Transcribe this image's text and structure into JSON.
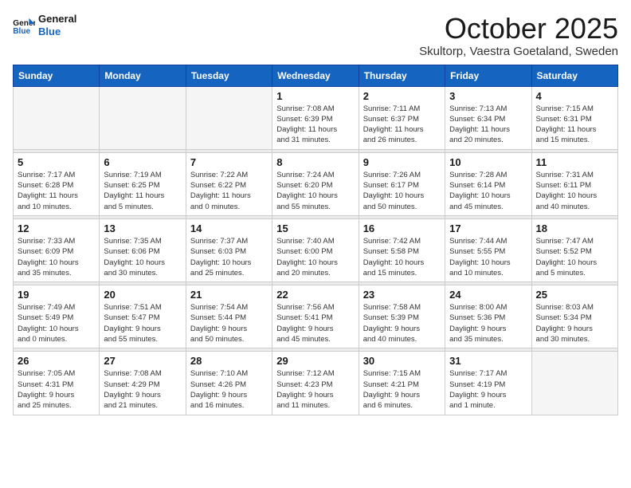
{
  "logo": {
    "line1": "General",
    "line2": "Blue"
  },
  "title": "October 2025",
  "location": "Skultorp, Vaestra Goetaland, Sweden",
  "days_of_week": [
    "Sunday",
    "Monday",
    "Tuesday",
    "Wednesday",
    "Thursday",
    "Friday",
    "Saturday"
  ],
  "weeks": [
    [
      {
        "day": "",
        "info": ""
      },
      {
        "day": "",
        "info": ""
      },
      {
        "day": "",
        "info": ""
      },
      {
        "day": "1",
        "info": "Sunrise: 7:08 AM\nSunset: 6:39 PM\nDaylight: 11 hours\nand 31 minutes."
      },
      {
        "day": "2",
        "info": "Sunrise: 7:11 AM\nSunset: 6:37 PM\nDaylight: 11 hours\nand 26 minutes."
      },
      {
        "day": "3",
        "info": "Sunrise: 7:13 AM\nSunset: 6:34 PM\nDaylight: 11 hours\nand 20 minutes."
      },
      {
        "day": "4",
        "info": "Sunrise: 7:15 AM\nSunset: 6:31 PM\nDaylight: 11 hours\nand 15 minutes."
      }
    ],
    [
      {
        "day": "5",
        "info": "Sunrise: 7:17 AM\nSunset: 6:28 PM\nDaylight: 11 hours\nand 10 minutes."
      },
      {
        "day": "6",
        "info": "Sunrise: 7:19 AM\nSunset: 6:25 PM\nDaylight: 11 hours\nand 5 minutes."
      },
      {
        "day": "7",
        "info": "Sunrise: 7:22 AM\nSunset: 6:22 PM\nDaylight: 11 hours\nand 0 minutes."
      },
      {
        "day": "8",
        "info": "Sunrise: 7:24 AM\nSunset: 6:20 PM\nDaylight: 10 hours\nand 55 minutes."
      },
      {
        "day": "9",
        "info": "Sunrise: 7:26 AM\nSunset: 6:17 PM\nDaylight: 10 hours\nand 50 minutes."
      },
      {
        "day": "10",
        "info": "Sunrise: 7:28 AM\nSunset: 6:14 PM\nDaylight: 10 hours\nand 45 minutes."
      },
      {
        "day": "11",
        "info": "Sunrise: 7:31 AM\nSunset: 6:11 PM\nDaylight: 10 hours\nand 40 minutes."
      }
    ],
    [
      {
        "day": "12",
        "info": "Sunrise: 7:33 AM\nSunset: 6:09 PM\nDaylight: 10 hours\nand 35 minutes."
      },
      {
        "day": "13",
        "info": "Sunrise: 7:35 AM\nSunset: 6:06 PM\nDaylight: 10 hours\nand 30 minutes."
      },
      {
        "day": "14",
        "info": "Sunrise: 7:37 AM\nSunset: 6:03 PM\nDaylight: 10 hours\nand 25 minutes."
      },
      {
        "day": "15",
        "info": "Sunrise: 7:40 AM\nSunset: 6:00 PM\nDaylight: 10 hours\nand 20 minutes."
      },
      {
        "day": "16",
        "info": "Sunrise: 7:42 AM\nSunset: 5:58 PM\nDaylight: 10 hours\nand 15 minutes."
      },
      {
        "day": "17",
        "info": "Sunrise: 7:44 AM\nSunset: 5:55 PM\nDaylight: 10 hours\nand 10 minutes."
      },
      {
        "day": "18",
        "info": "Sunrise: 7:47 AM\nSunset: 5:52 PM\nDaylight: 10 hours\nand 5 minutes."
      }
    ],
    [
      {
        "day": "19",
        "info": "Sunrise: 7:49 AM\nSunset: 5:49 PM\nDaylight: 10 hours\nand 0 minutes."
      },
      {
        "day": "20",
        "info": "Sunrise: 7:51 AM\nSunset: 5:47 PM\nDaylight: 9 hours\nand 55 minutes."
      },
      {
        "day": "21",
        "info": "Sunrise: 7:54 AM\nSunset: 5:44 PM\nDaylight: 9 hours\nand 50 minutes."
      },
      {
        "day": "22",
        "info": "Sunrise: 7:56 AM\nSunset: 5:41 PM\nDaylight: 9 hours\nand 45 minutes."
      },
      {
        "day": "23",
        "info": "Sunrise: 7:58 AM\nSunset: 5:39 PM\nDaylight: 9 hours\nand 40 minutes."
      },
      {
        "day": "24",
        "info": "Sunrise: 8:00 AM\nSunset: 5:36 PM\nDaylight: 9 hours\nand 35 minutes."
      },
      {
        "day": "25",
        "info": "Sunrise: 8:03 AM\nSunset: 5:34 PM\nDaylight: 9 hours\nand 30 minutes."
      }
    ],
    [
      {
        "day": "26",
        "info": "Sunrise: 7:05 AM\nSunset: 4:31 PM\nDaylight: 9 hours\nand 25 minutes."
      },
      {
        "day": "27",
        "info": "Sunrise: 7:08 AM\nSunset: 4:29 PM\nDaylight: 9 hours\nand 21 minutes."
      },
      {
        "day": "28",
        "info": "Sunrise: 7:10 AM\nSunset: 4:26 PM\nDaylight: 9 hours\nand 16 minutes."
      },
      {
        "day": "29",
        "info": "Sunrise: 7:12 AM\nSunset: 4:23 PM\nDaylight: 9 hours\nand 11 minutes."
      },
      {
        "day": "30",
        "info": "Sunrise: 7:15 AM\nSunset: 4:21 PM\nDaylight: 9 hours\nand 6 minutes."
      },
      {
        "day": "31",
        "info": "Sunrise: 7:17 AM\nSunset: 4:19 PM\nDaylight: 9 hours\nand 1 minute."
      },
      {
        "day": "",
        "info": ""
      }
    ]
  ]
}
